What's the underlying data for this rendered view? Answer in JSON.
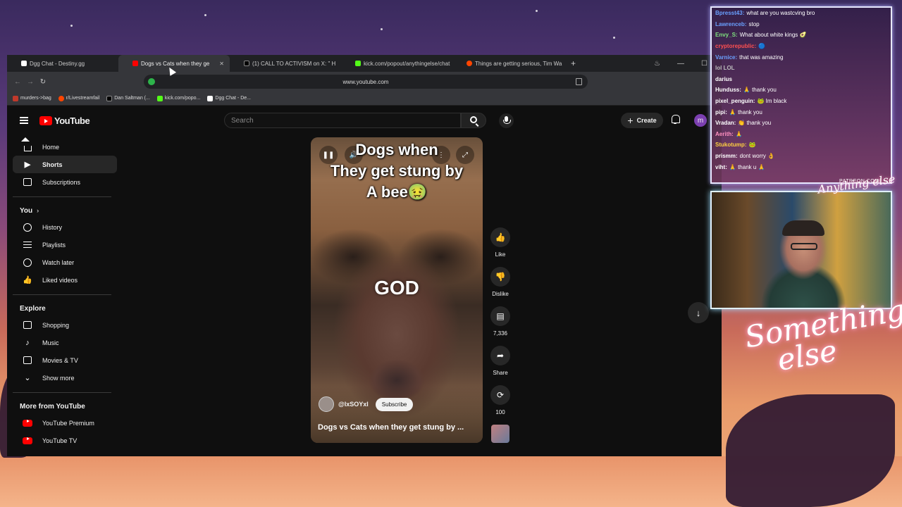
{
  "browser": {
    "tabs": [
      {
        "label": "Dgg Chat - Destiny.gg",
        "color": "#ffffff",
        "active": false
      },
      {
        "label": "Dogs vs Cats when they ge",
        "color": "#ff0000",
        "active": true
      },
      {
        "label": "(1) CALL TO ACTIVISM on X: \" H",
        "color": "#000000",
        "active": false
      },
      {
        "label": "kick.com/popout/anythingelse/chat",
        "color": "#53fc18",
        "active": false
      },
      {
        "label": "Things are getting serious, Tim Wa",
        "color": "#ff4500",
        "active": false
      }
    ],
    "url": "www.youtube.com",
    "bookmarks": [
      {
        "label": "murders->bag",
        "color": "#c0392b"
      },
      {
        "label": "r/Livestreamfail",
        "color": "#ff4500"
      },
      {
        "label": "Dan Saltman (...",
        "color": "#000000"
      },
      {
        "label": "kick.com/popo...",
        "color": "#53fc18"
      },
      {
        "label": "Dgg Chat - De...",
        "color": "#ffffff"
      }
    ]
  },
  "youtube": {
    "logo_text": "YouTube",
    "search_placeholder": "Search",
    "create_label": "Create",
    "avatar_letter": "m",
    "sidebar": {
      "main": [
        {
          "label": "Home",
          "icon": "home-icon"
        },
        {
          "label": "Shorts",
          "icon": "shorts-icon"
        },
        {
          "label": "Subscriptions",
          "icon": "subscriptions-icon"
        }
      ],
      "you_title": "You",
      "you": [
        {
          "label": "History",
          "icon": "history-icon"
        },
        {
          "label": "Playlists",
          "icon": "playlists-icon"
        },
        {
          "label": "Watch later",
          "icon": "watch-later-icon"
        },
        {
          "label": "Liked videos",
          "icon": "liked-videos-icon"
        }
      ],
      "explore_title": "Explore",
      "explore": [
        {
          "label": "Shopping",
          "icon": "shopping-icon"
        },
        {
          "label": "Music",
          "icon": "music-icon"
        },
        {
          "label": "Movies & TV",
          "icon": "movies-icon"
        },
        {
          "label": "Show more",
          "icon": "chevron-down-icon"
        }
      ],
      "more_title": "More from YouTube",
      "more": [
        {
          "label": "YouTube Premium",
          "icon": "youtube-premium-icon"
        },
        {
          "label": "YouTube TV",
          "icon": "youtube-tv-icon"
        }
      ]
    },
    "short": {
      "caption_lines": [
        "Dogs when",
        "They get stung by",
        "A bee🤢"
      ],
      "overlay_word": "GOD",
      "channel": "@lxSOYxl",
      "subscribe_label": "Subscribe",
      "title": "Dogs vs Cats when they get stung by ..."
    },
    "actions": {
      "like": "Like",
      "dislike": "Dislike",
      "comments": "7,336",
      "share": "Share",
      "remix": "100"
    }
  },
  "chat": {
    "messages": [
      {
        "user": "Bpresst43:",
        "text": "what are you wastcving bro",
        "color": "#6aa0ff"
      },
      {
        "user": "Lawrenceb:",
        "text": "stop",
        "color": "#6aa0ff"
      },
      {
        "user": "Envy_S:",
        "text": "What about white kings 🥑",
        "color": "#7ee07e"
      },
      {
        "user": "cryptorepublic:",
        "text": "🔵",
        "color": "#ff5050"
      },
      {
        "user": "Varnice:",
        "text": "that was amazing",
        "color": "#6aa0ff"
      },
      {
        "user": "lol LOL",
        "text": "",
        "color": "#bbbbbb"
      },
      {
        "user": "darius",
        "text": "",
        "color": "#ffffff"
      },
      {
        "user": "Hunduss:",
        "text": "🙏 thank you",
        "color": "#ffffff"
      },
      {
        "user": "pixel_penguin:",
        "text": "🐸 Im black",
        "color": "#ffffff"
      },
      {
        "user": "pipi:",
        "text": "🙏 thank you",
        "color": "#ffffff"
      },
      {
        "user": "Vradan:",
        "text": "👏 thank you",
        "color": "#ffffff"
      },
      {
        "user": "Aerith:",
        "text": "🙏",
        "color": "#ff90c0"
      },
      {
        "user": "Stukotump:",
        "text": "🐸",
        "color": "#ffd040"
      },
      {
        "user": "prismm:",
        "text": "dont worry 👌",
        "color": "#ffffff"
      },
      {
        "user": "viht:",
        "text": "🙏 thank u 🙏",
        "color": "#ffffff"
      }
    ],
    "patreon": "PATREON.COM/"
  },
  "overlay": {
    "neon_line1": "Something",
    "neon_line2": "else",
    "logo_small": "Anything else"
  },
  "colors": {
    "accent": "#ff0000",
    "yt_bg": "#0f0f0f",
    "subscribe_bg": "#f1f1f1"
  }
}
